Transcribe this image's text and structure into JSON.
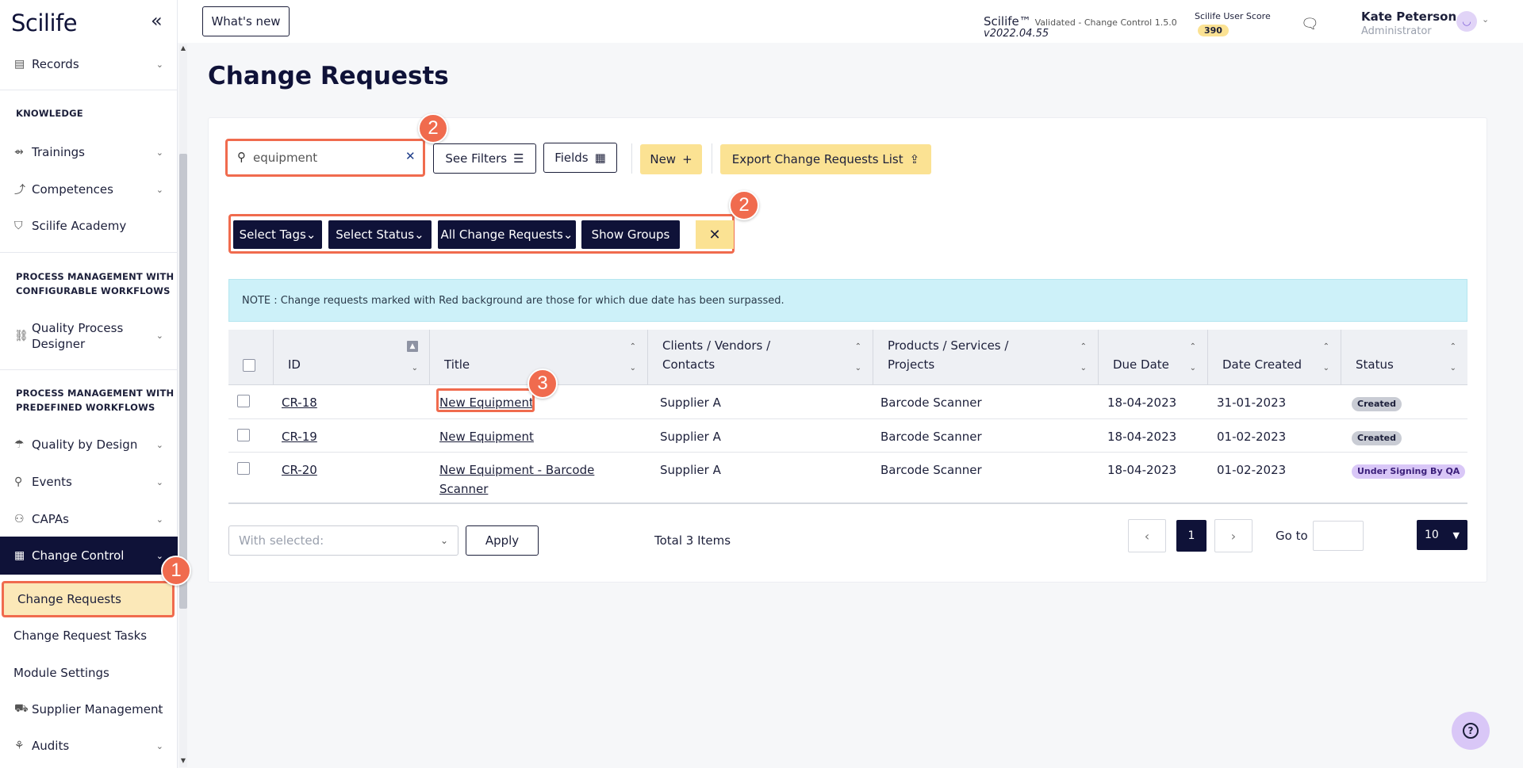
{
  "app": {
    "logo": "Scilife"
  },
  "sidebar": {
    "collapse_icon": "double-chevron-left-icon",
    "items": {
      "records": "Records",
      "knowledge_header": "KNOWLEDGE",
      "trainings": "Trainings",
      "competences": "Competences",
      "academy": "Scilife Academy",
      "pm_configurable_1": "PROCESS MANAGEMENT WITH",
      "pm_configurable_2": "CONFIGURABLE WORKFLOWS",
      "qpd_1": "Quality Process",
      "qpd_2": "Designer",
      "pm_predefined_1": "PROCESS MANAGEMENT WITH",
      "pm_predefined_2": "PREDEFINED WORKFLOWS",
      "qbd": "Quality by Design",
      "events": "Events",
      "capas": "CAPAs",
      "change_control": "Change Control",
      "change_requests": "Change Requests",
      "cr_tasks": "Change Request Tasks",
      "module_settings": "Module Settings",
      "supplier_mgmt": "Supplier Management",
      "audits": "Audits"
    }
  },
  "topbar": {
    "whats_new": "What's new",
    "brand": "Scilife™",
    "validated": "Validated - Change Control 1.5.0",
    "version": "v2022.04.55",
    "score_label": "Scilife User Score",
    "score_value": "390",
    "user_name": "Kate Peterson",
    "user_role": "Administrator"
  },
  "page": {
    "title": "Change Requests"
  },
  "toolbar": {
    "search_value": "equipment",
    "see_filters": "See Filters",
    "fields": "Fields",
    "new": "New",
    "export": "Export Change Requests List"
  },
  "filters": {
    "tags": "Select Tags",
    "status": "Select Status",
    "all": "All Change Requests",
    "groups": "Show Groups"
  },
  "note": "NOTE : Change requests marked with Red background are those for which due date has been surpassed.",
  "table": {
    "columns": {
      "id": "ID",
      "title": "Title",
      "clients_1": "Clients / Vendors /",
      "clients_2": "Contacts",
      "products_1": "Products / Services /",
      "products_2": "Projects",
      "due": "Due Date",
      "created": "Date Created",
      "status": "Status"
    },
    "rows": [
      {
        "id": "CR-18",
        "title": "New Equipment",
        "title2": "",
        "client": "Supplier A",
        "product": "Barcode Scanner",
        "due": "18-04-2023",
        "created": "31-01-2023",
        "status": "Created"
      },
      {
        "id": "CR-19",
        "title": "New Equipment",
        "title2": "",
        "client": "Supplier A",
        "product": "Barcode Scanner",
        "due": "18-04-2023",
        "created": "01-02-2023",
        "status": "Created"
      },
      {
        "id": "CR-20",
        "title": "New Equipment - Barcode",
        "title2": "Scanner",
        "client": "Supplier A",
        "product": "Barcode Scanner",
        "due": "18-04-2023",
        "created": "01-02-2023",
        "status": "Under Signing By QA"
      }
    ]
  },
  "footer": {
    "with_selected": "With selected:",
    "apply": "Apply",
    "total": "Total 3 Items",
    "page": "1",
    "goto": "Go to",
    "per_page": "10"
  },
  "annotations": {
    "one": "1",
    "two": "2",
    "three": "3"
  },
  "colors": {
    "navy": "#0f1238",
    "yellow": "#fbe293",
    "callout": "#f06b4e",
    "note_bg": "#cdf1f9"
  }
}
